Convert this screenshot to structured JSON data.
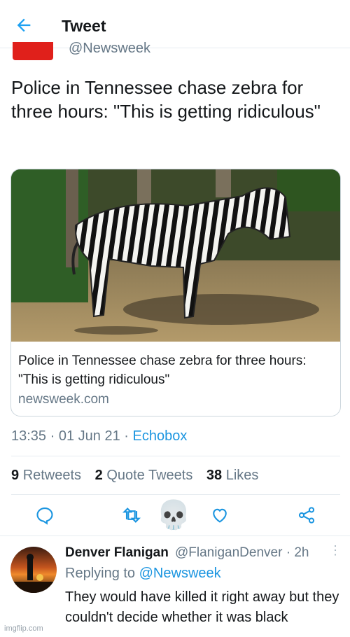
{
  "header": {
    "title": "Tweet",
    "back_icon": "arrow-left-icon"
  },
  "tweet": {
    "handle": "@Newsweek",
    "text": "Police in Tennessee chase zebra for three hours: \"This is getting ridiculous\"",
    "card": {
      "title": "Police in Tennessee chase zebra for three hours: \"This is getting ridiculous\"",
      "domain": "newsweek.com"
    },
    "time": "13:35",
    "date": "01 Jun 21",
    "source": "Echobox",
    "retweets_count": "9",
    "retweets_label": "Retweets",
    "quotes_count": "2",
    "quotes_label": "Quote Tweets",
    "likes_count": "38",
    "likes_label": "Likes"
  },
  "actions": [
    "reply-icon",
    "retweet-icon",
    "like-icon",
    "share-icon"
  ],
  "overlay_emoji": "💀",
  "reply": {
    "name": "Denver Flanigan",
    "handle": "@FlaniganDenver",
    "time": "2h",
    "replying_label": "Replying to",
    "replying_to": "@Newsweek",
    "text": "They would have killed it right away but they couldn't decide whether it was black"
  },
  "watermark": "imgflip.com",
  "colors": {
    "link": "#1b95e0",
    "muted": "#657786",
    "text": "#14171a",
    "brand_red": "#e0201b"
  }
}
